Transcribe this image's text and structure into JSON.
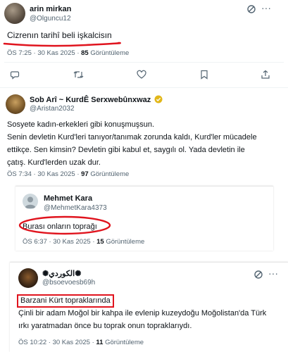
{
  "tweets": [
    {
      "name": "arin mirkan",
      "handle": "@Olguncu12",
      "text": "Cizrenın tarihî  beli işkalcisın",
      "time": "ÖS 7:25",
      "date": "30 Kas 2025",
      "views": "85",
      "views_label": "Görüntüleme"
    },
    {
      "name": "Sob Arî ~ KurdÊ Serxwebûnxwaz",
      "handle": "@Aristan2032",
      "text_lines": [
        "Sosyete kadın-erkekleri gibi konuşmuşsun.",
        "Senin devletin Kurd'leri tanıyor/tanımak zorunda kaldı, Kurd'ler mücadele",
        "ettikçe. Sen kimsin? Devletin gibi kabul et, saygılı ol. Yada devletin ile",
        "çatış. Kurd'lerden uzak dur."
      ],
      "time": "ÖS 7:34",
      "date": "30 Kas 2025",
      "views": "97",
      "views_label": "Görüntüleme"
    },
    {
      "name": "Mehmet Kara",
      "handle": "@MehmetKara4373",
      "text": "Burası onların toprağı",
      "time": "ÖS 6:37",
      "date": "30 Kas 2025",
      "views": "15",
      "views_label": "Görüntüleme"
    },
    {
      "name": "✺الكوردي✺",
      "handle": "@bsoevoesb69h",
      "text_boxed": "Barzani Kürt topraklarında",
      "text_lines": [
        "Çinli bir adam Moğol bir kahpa ile evlenip kuzeydoğu Moğolistan'da Türk",
        "ırkı yaratmadan önce bu toprak onun topraklarıydı."
      ],
      "time": "ÖS 10:22",
      "date": "30 Kas 2025",
      "views": "11",
      "views_label": "Görüntüleme"
    }
  ],
  "separator": "·",
  "icons": [
    "grok-icon",
    "more-icon",
    "reply-icon",
    "retweet-icon",
    "like-icon",
    "bookmark-icon",
    "share-icon",
    "verified-badge-icon"
  ],
  "colors": {
    "annotation_red": "#e0141e",
    "secondary_text": "#536471",
    "gold_verified": "#e2b719"
  }
}
